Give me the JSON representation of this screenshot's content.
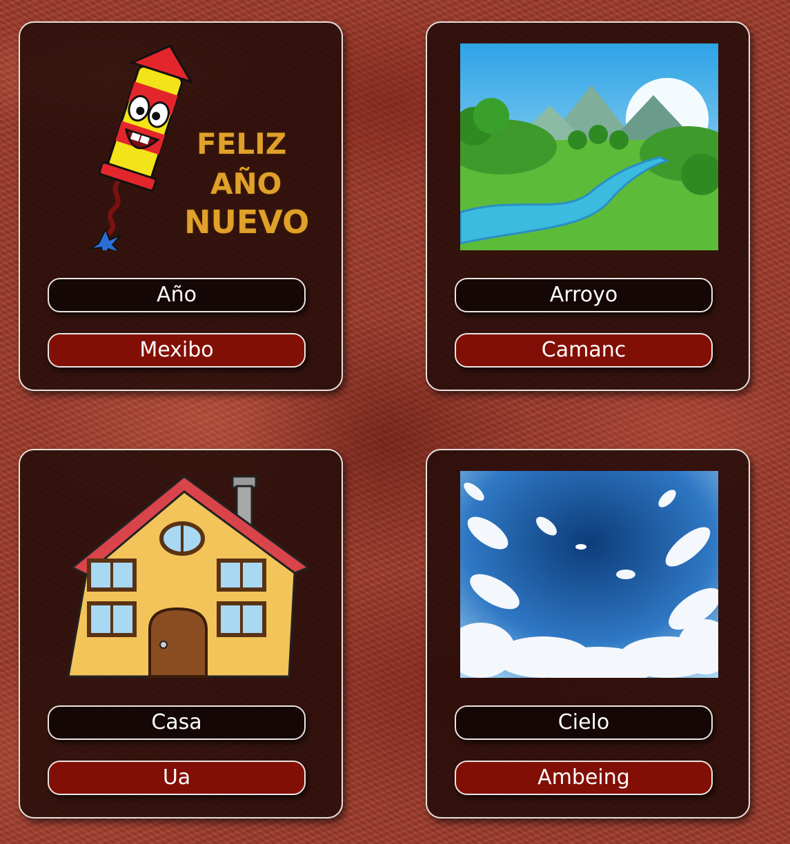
{
  "cards": [
    {
      "image": "fireworks-rocket-feliz-ano-nuevo-illustration",
      "image_text": [
        "FELIZ",
        "AÑO",
        "NUEVO"
      ],
      "word": "Año",
      "answer": "Mexibo"
    },
    {
      "image": "river-landscape-illustration",
      "word": "Arroyo",
      "answer": "Camanc"
    },
    {
      "image": "cartoon-house-illustration",
      "word": "Casa",
      "answer": "Ua"
    },
    {
      "image": "blue-sky-clouds-illustration",
      "word": "Cielo",
      "answer": "Ambeing"
    }
  ],
  "colors": {
    "card_background": "#230c08",
    "word_pill": "#140706",
    "answer_pill": "#820f05",
    "border": "#ece7e3",
    "text": "#ffffff"
  }
}
